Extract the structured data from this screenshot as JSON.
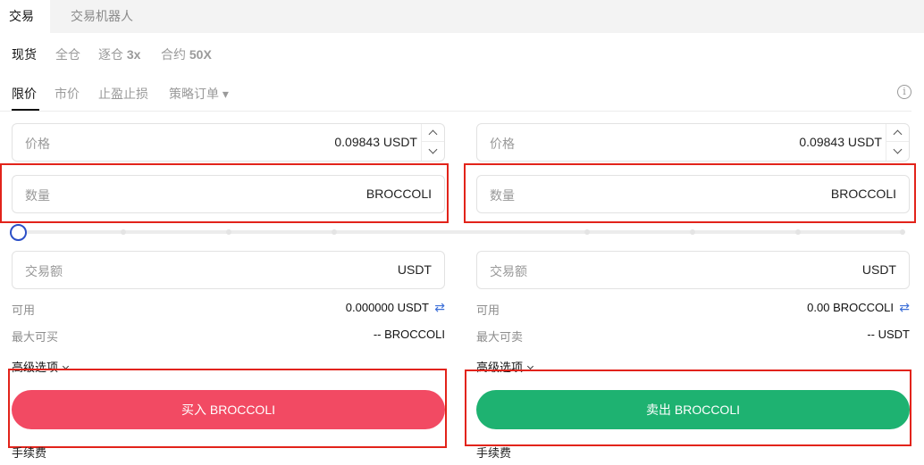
{
  "tabs": {
    "active": "交易",
    "robot": "交易机器人"
  },
  "mode_tabs": {
    "spot": "现货",
    "cross": "全仓",
    "isolated_prefix": "逐仓",
    "isolated_lev": "3x",
    "contract_prefix": "合约",
    "contract_lev": "50X"
  },
  "order_tabs": {
    "limit": "限价",
    "market": "市价",
    "tpsl": "止盈止损",
    "strategy": "策略订单 ▾"
  },
  "info_icon": "i",
  "buy": {
    "price_label": "价格",
    "price_value": "0.09843",
    "price_unit": "USDT",
    "qty_label": "数量",
    "qty_unit": "BROCCOLI",
    "amount_label": "交易额",
    "amount_unit": "USDT",
    "available_label": "可用",
    "available_value": "0.000000 USDT",
    "max_label": "最大可买",
    "max_value": "-- BROCCOLI",
    "advanced": "高级选项",
    "button": "买入 BROCCOLI",
    "fee": "手续费"
  },
  "sell": {
    "price_label": "价格",
    "price_value": "0.09843",
    "price_unit": "USDT",
    "qty_label": "数量",
    "qty_unit": "BROCCOLI",
    "amount_label": "交易额",
    "amount_unit": "USDT",
    "available_label": "可用",
    "available_value": "0.00 BROCCOLI",
    "max_label": "最大可卖",
    "max_value": "-- USDT",
    "advanced": "高级选项",
    "button": "卖出 BROCCOLI",
    "fee": "手续费"
  },
  "swap_icon": "⇄",
  "slider_progress": 0,
  "colors": {
    "buy": "#f24a63",
    "sell": "#1eb271",
    "highlight": "#e2231a",
    "slider": "#2b4fc7"
  }
}
